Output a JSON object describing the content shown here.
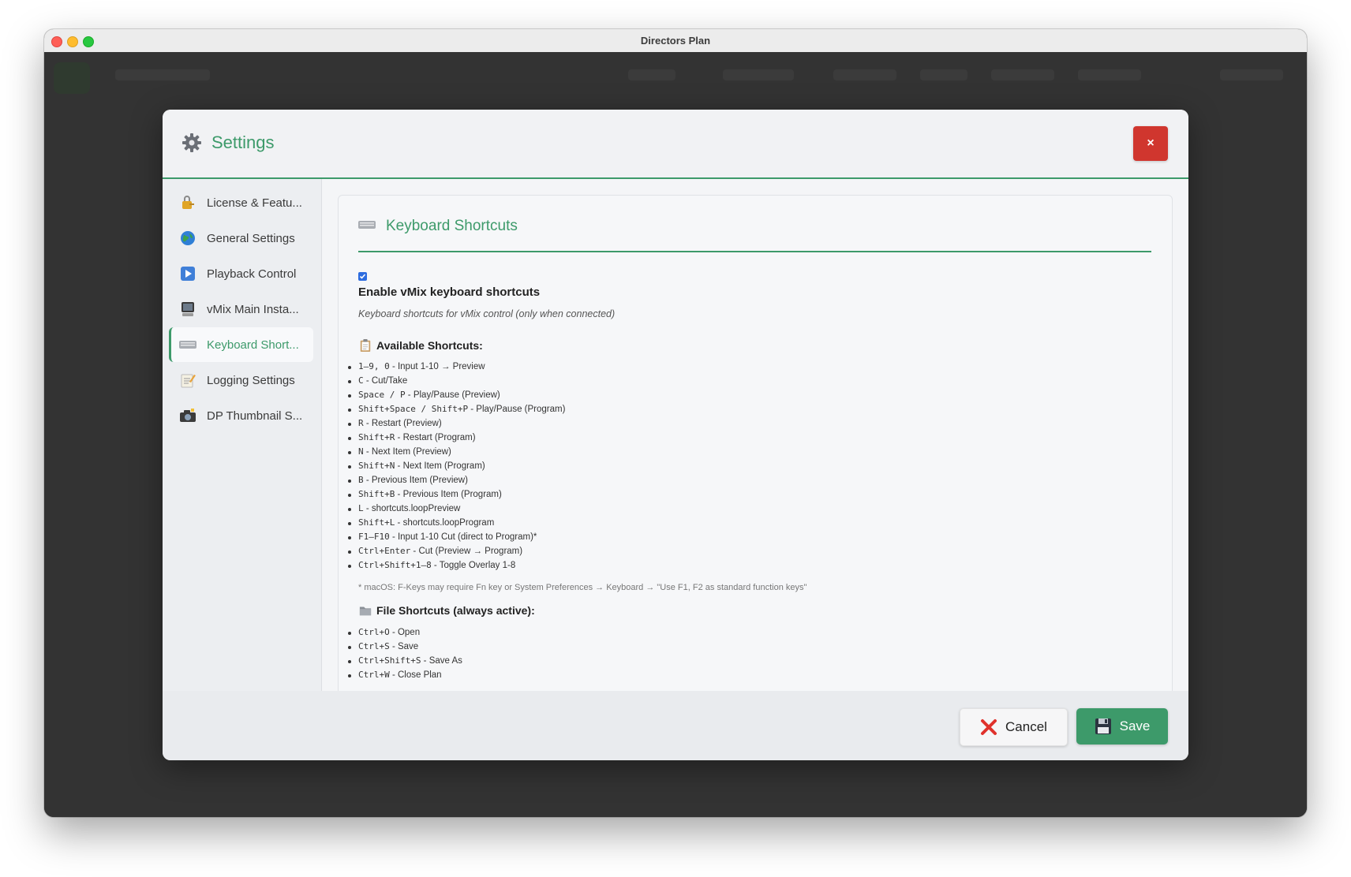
{
  "window": {
    "title": "Directors Plan"
  },
  "modal": {
    "title": "Settings",
    "close_label": "×",
    "sidebar": {
      "items": [
        {
          "label": "License & Featu...",
          "icon": "lock-key-icon"
        },
        {
          "label": "General Settings",
          "icon": "globe-icon"
        },
        {
          "label": "Playback Control",
          "icon": "play-button-icon"
        },
        {
          "label": "vMix Main Insta...",
          "icon": "computer-icon"
        },
        {
          "label": "Keyboard Short...",
          "icon": "keyboard-icon",
          "active": true
        },
        {
          "label": "Logging Settings",
          "icon": "memo-icon"
        },
        {
          "label": "DP Thumbnail S...",
          "icon": "camera-icon"
        }
      ]
    },
    "section": {
      "title": "Keyboard Shortcuts",
      "enable_label": "Enable vMix keyboard shortcuts",
      "enable_checked": true,
      "enable_desc": "Keyboard shortcuts for vMix control (only when connected)",
      "available_title": "Available Shortcuts:",
      "shortcuts": [
        {
          "key": "1–9, 0",
          "desc": " - Input 1-10 → Preview"
        },
        {
          "key": "C",
          "desc": " - Cut/Take"
        },
        {
          "key": "Space / P",
          "desc": " - Play/Pause (Preview)"
        },
        {
          "key": "Shift+Space / Shift+P",
          "desc": " - Play/Pause (Program)"
        },
        {
          "key": "R",
          "desc": " - Restart (Preview)"
        },
        {
          "key": "Shift+R",
          "desc": " - Restart (Program)"
        },
        {
          "key": "N",
          "desc": " - Next Item (Preview)"
        },
        {
          "key": "Shift+N",
          "desc": " - Next Item (Program)"
        },
        {
          "key": "B",
          "desc": " - Previous Item (Preview)"
        },
        {
          "key": "Shift+B",
          "desc": " - Previous Item (Program)"
        },
        {
          "key": "L",
          "desc": " - shortcuts.loopPreview"
        },
        {
          "key": "Shift+L",
          "desc": " - shortcuts.loopProgram"
        },
        {
          "key": "F1–F10",
          "desc": " - Input 1-10 Cut (direct to Program)*"
        },
        {
          "key": "Ctrl+Enter",
          "desc": " - Cut (Preview → Program)"
        },
        {
          "key": "Ctrl+Shift+1–8",
          "desc": " - Toggle Overlay 1-8"
        }
      ],
      "footnote": "* macOS: F-Keys may require Fn key or System Preferences → Keyboard → \"Use F1, F2 as standard function keys\"",
      "file_title": "File Shortcuts (always active):",
      "file_shortcuts": [
        {
          "key": "Ctrl+O",
          "desc": " - Open"
        },
        {
          "key": "Ctrl+S",
          "desc": " - Save"
        },
        {
          "key": "Ctrl+Shift+S",
          "desc": " - Save As"
        },
        {
          "key": "Ctrl+W",
          "desc": " - Close Plan"
        }
      ]
    },
    "footer": {
      "cancel_label": "Cancel",
      "save_label": "Save"
    }
  },
  "colors": {
    "accent": "#3d9a6a",
    "danger": "#d0362e",
    "checkbox": "#2d6cdf"
  }
}
